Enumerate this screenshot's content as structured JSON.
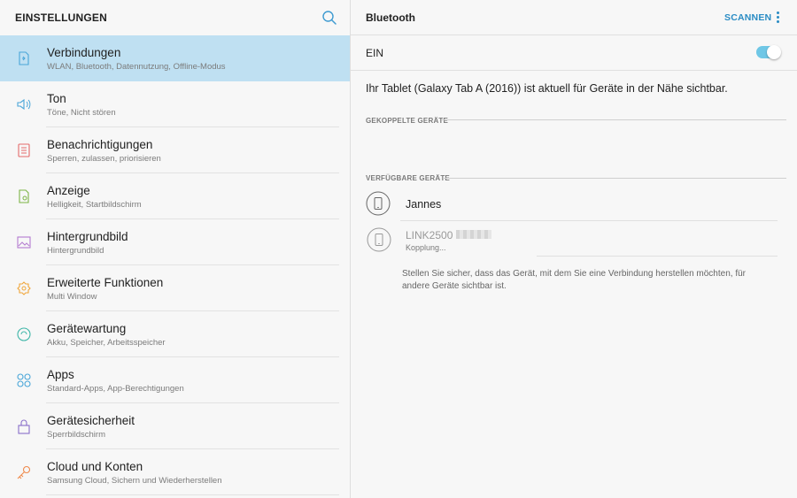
{
  "settings": {
    "title": "EINSTELLUNGEN",
    "search_icon": "search-icon"
  },
  "menu": [
    {
      "title": "Verbindungen",
      "subtitle": "WLAN, Bluetooth, Datennutzung, Offline-Modus",
      "icon": "connections-icon",
      "active": true
    },
    {
      "title": "Ton",
      "subtitle": "Töne, Nicht stören",
      "icon": "speaker-icon"
    },
    {
      "title": "Benachrichtigungen",
      "subtitle": "Sperren, zulassen, priorisieren",
      "icon": "notifications-icon"
    },
    {
      "title": "Anzeige",
      "subtitle": "Helligkeit, Startbildschirm",
      "icon": "display-icon"
    },
    {
      "title": "Hintergrundbild",
      "subtitle": "Hintergrundbild",
      "icon": "wallpaper-icon"
    },
    {
      "title": "Erweiterte Funktionen",
      "subtitle": "Multi Window",
      "icon": "advanced-features-icon"
    },
    {
      "title": "Gerätewartung",
      "subtitle": "Akku, Speicher, Arbeitsspeicher",
      "icon": "device-maintenance-icon"
    },
    {
      "title": "Apps",
      "subtitle": "Standard-Apps, App-Berechtigungen",
      "icon": "apps-icon"
    },
    {
      "title": "Gerätesicherheit",
      "subtitle": "Sperrbildschirm",
      "icon": "lock-icon"
    },
    {
      "title": "Cloud und Konten",
      "subtitle": "Samsung Cloud, Sichern und Wiederherstellen",
      "icon": "key-icon"
    }
  ],
  "bluetooth": {
    "title": "Bluetooth",
    "scan_label": "SCANNEN",
    "toggle_label": "EIN",
    "toggle_on": true,
    "visibility_text": "Ihr Tablet (Galaxy Tab A (2016)) ist aktuell für Geräte in der Nähe sichtbar.",
    "paired_header": "GEKOPPELTE GERÄTE",
    "available_header": "VERFÜGBARE GERÄTE",
    "devices": [
      {
        "name": "Jannes",
        "status": "",
        "icon": "phone-icon"
      },
      {
        "name": "LINK2500",
        "status": "Kopplung...",
        "icon": "phone-icon"
      }
    ],
    "hint": "Stellen Sie sicher, dass das Gerät, mit dem Sie eine Verbindung herstellen möchten, für andere Geräte sichtbar ist."
  },
  "colors": {
    "accent": "#2a8cc4",
    "active_row": "#bfe0f2",
    "toggle": "#6fc7e6"
  }
}
